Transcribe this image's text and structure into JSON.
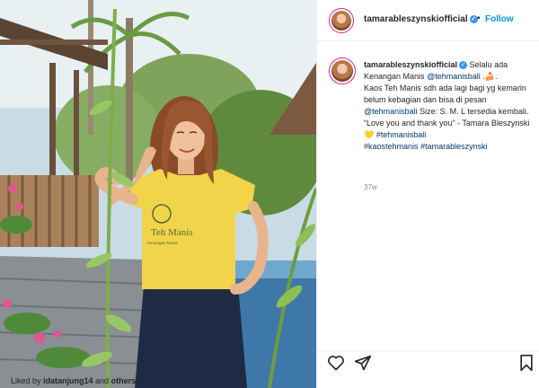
{
  "post": {
    "username": "tamarableszynskiofficial",
    "verified": true,
    "follow_label": "Follow",
    "dot": "•",
    "caption": {
      "line1_text": " Selalu ada Kenangan Manis ",
      "line1_mention": "@tehmanisbali",
      "line1_end": " .🍰.",
      "line2_text": "Kaos Teh Manis sdh ada lagi bagi yg kemarin belum kebagian dan bisa di pesan ",
      "line2_mention": "@tehmanisbali",
      "line2_end": " Size: S. M. L tersedia kembali.",
      "line3_text": "“Love you and thank you” - Tamara Bleszynski ",
      "line3_emoji": "💛",
      "line3_tag": "#tehmanisbali",
      "line4_tag1": "#kaostehmanis",
      "line4_tag2": "#tamarableszynski"
    },
    "time_ago": "37w",
    "liked_prefix": "Liked by ",
    "liked_user": "idatanjung14",
    "liked_mid": " and ",
    "liked_others": "others",
    "shirt_text_1": "Teh Manis",
    "shirt_text_2": "Kenangan Manis"
  },
  "icons": [
    "verified-icon",
    "heart-icon",
    "share-icon",
    "bookmark-icon"
  ],
  "colors": {
    "accent": "#0095f6",
    "link": "#00376b",
    "muted": "#8e8e8e",
    "shirt": "#f2d44a"
  }
}
